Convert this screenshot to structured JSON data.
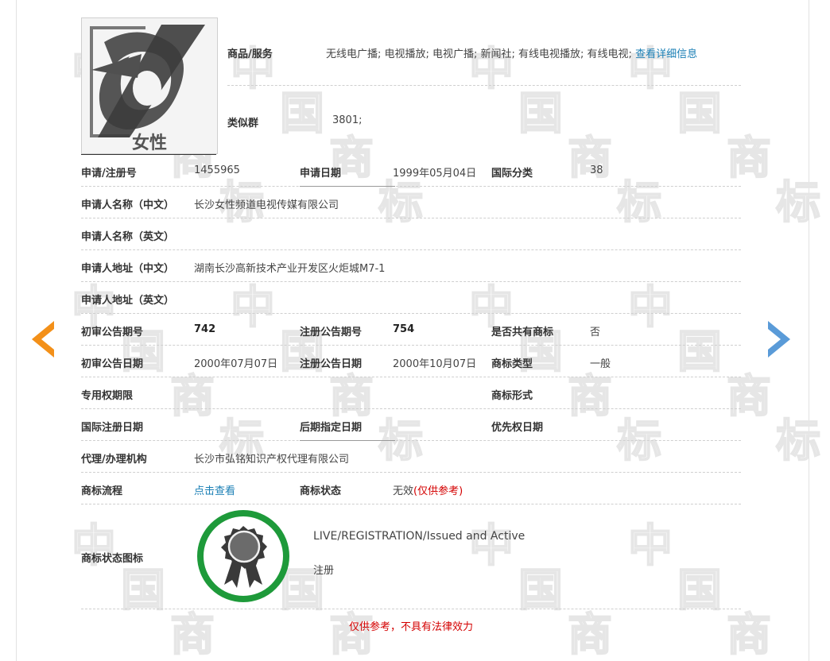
{
  "colors": {
    "accent_link": "#1a7fb5",
    "warning_red": "#d40000",
    "seal_green": "#1e9a3a",
    "prev_arrow": "#f39019",
    "next_arrow": "#5a9bd8"
  },
  "logo": {
    "text": "女性"
  },
  "watermark": [
    "中",
    "国",
    "商",
    "标"
  ],
  "goods": {
    "label": "商品/服务",
    "value": "无线电广播; 电视播放; 电视广播; 新闻社; 有线电视播放; 有线电视;",
    "link": "查看详细信息"
  },
  "similar": {
    "label": "类似群",
    "value": "3801;"
  },
  "rows": {
    "reg_no_label": "申请/注册号",
    "reg_no": "1455965",
    "app_date_label": "申请日期",
    "app_date": "1999年05月04日",
    "intl_class_label": "国际分类",
    "intl_class": "38",
    "applicant_cn_label": "申请人名称（中文）",
    "applicant_cn": "长沙女性频道电视传媒有限公司",
    "applicant_en_label": "申请人名称（英文）",
    "address_cn_label": "申请人地址（中文）",
    "address_cn": "湖南长沙高新技术产业开发区火炬城M7-1",
    "address_en_label": "申请人地址（英文）",
    "prelim_no_label": "初审公告期号",
    "prelim_no": "742",
    "reg_pub_no_label": "注册公告期号",
    "reg_pub_no": "754",
    "shared_label": "是否共有商标",
    "shared": "否",
    "prelim_date_label": "初审公告日期",
    "prelim_date": "2000年07月07日",
    "reg_pub_date_label": "注册公告日期",
    "reg_pub_date": "2000年10月07日",
    "tm_type_label": "商标类型",
    "tm_type": "一般",
    "exclusive_label": "专用权期限",
    "tm_form_label": "商标形式",
    "intl_reg_date_label": "国际注册日期",
    "later_date_label": "后期指定日期",
    "priority_date_label": "优先权日期",
    "agent_label": "代理/办理机构",
    "agent": "长沙市弘铭知识产权代理有限公司",
    "process_label": "商标流程",
    "process_link": "点击查看",
    "status_label": "商标状态",
    "status": "无效",
    "status_note": "(仅供参考)"
  },
  "status_icon": {
    "label": "商标状态图标",
    "line1": "LIVE/REGISTRATION/Issued and Active",
    "line2": "注册"
  },
  "disclaimer": "仅供参考，不具有法律效力"
}
